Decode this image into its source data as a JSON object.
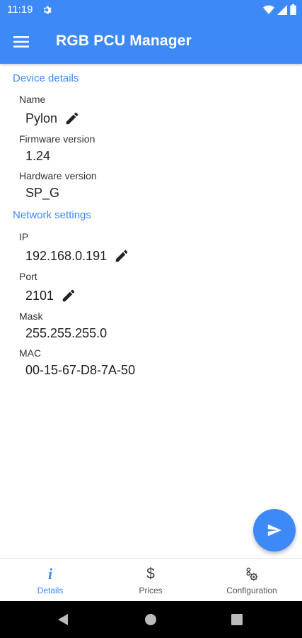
{
  "status_bar": {
    "time": "11:19"
  },
  "app_bar": {
    "title": "RGB PCU Manager"
  },
  "sections": {
    "device_details": {
      "title": "Device details",
      "name_label": "Name",
      "name_value": "Pylon",
      "firmware_label": "Firmware version",
      "firmware_value": "1.24",
      "hardware_label": "Hardware version",
      "hardware_value": "SP_G"
    },
    "network_settings": {
      "title": "Network settings",
      "ip_label": "IP",
      "ip_value": "192.168.0.191",
      "port_label": "Port",
      "port_value": "2101",
      "mask_label": "Mask",
      "mask_value": "255.255.255.0",
      "mac_label": "MAC",
      "mac_value": "00-15-67-D8-7A-50"
    }
  },
  "bottom_nav": {
    "items": [
      {
        "label": "Details",
        "icon": "info-icon",
        "active": true
      },
      {
        "label": "Prices",
        "icon": "dollar-icon",
        "active": false
      },
      {
        "label": "Configuration",
        "icon": "settings-icon",
        "active": false
      }
    ]
  },
  "colors": {
    "primary": "#3d8af7",
    "text": "#1f1f1f",
    "label": "#333333"
  }
}
